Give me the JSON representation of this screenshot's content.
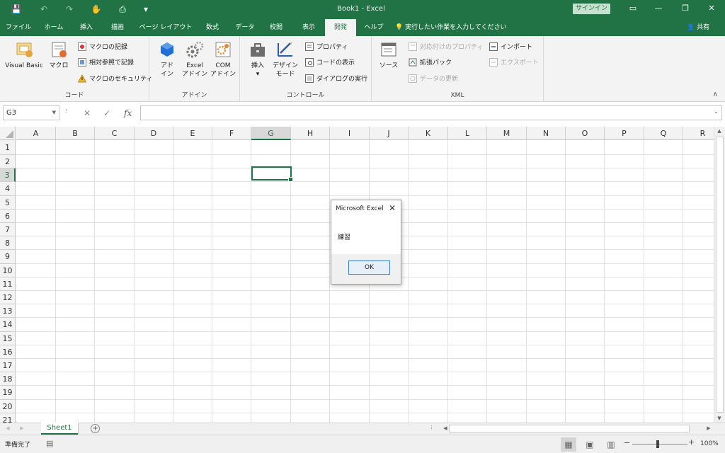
{
  "app": {
    "title": "Book1  -  Excel",
    "signin": "サインイン"
  },
  "quick_access": [
    {
      "icon": "save-icon",
      "glyph": "💾"
    },
    {
      "icon": "undo-icon",
      "glyph": "↶"
    },
    {
      "icon": "redo-icon",
      "glyph": "↷"
    },
    {
      "icon": "touch-mode-icon",
      "glyph": "✋"
    },
    {
      "icon": "print-preview-icon",
      "glyph": "⎙"
    },
    {
      "icon": "customize-icon",
      "glyph": "▾"
    }
  ],
  "window_buttons": [
    {
      "icon": "ribbon-display-icon",
      "glyph": "▭"
    },
    {
      "icon": "minimize-icon",
      "glyph": "—"
    },
    {
      "icon": "restore-icon",
      "glyph": "❐"
    },
    {
      "icon": "close-icon",
      "glyph": "✕"
    }
  ],
  "tabs": [
    {
      "label": "ファイル",
      "active": false
    },
    {
      "label": "ホーム",
      "active": false
    },
    {
      "label": "挿入",
      "active": false
    },
    {
      "label": "描画",
      "active": false
    },
    {
      "label": "ページ レイアウト",
      "active": false
    },
    {
      "label": "数式",
      "active": false
    },
    {
      "label": "データ",
      "active": false
    },
    {
      "label": "校閲",
      "active": false
    },
    {
      "label": "表示",
      "active": false
    },
    {
      "label": "開発",
      "active": true
    },
    {
      "label": "ヘルプ",
      "active": false
    }
  ],
  "tellme": "実行したい作業を入力してください",
  "share": "共有",
  "ribbon": {
    "code": {
      "label": "コード",
      "vb": "Visual Basic",
      "macro": "マクロ",
      "record": "マクロの記録",
      "relative": "相対参照で記録",
      "security": "マクロのセキュリティ"
    },
    "addins": {
      "label": "アドイン",
      "addin_1": "アド",
      "addin_2": "イン",
      "excel_1": "Excel",
      "excel_2": "アドイン",
      "com_1": "COM",
      "com_2": "アドイン"
    },
    "controls": {
      "label": "コントロール",
      "insert": "挿入",
      "design_1": "デザイン",
      "design_2": "モード",
      "properties": "プロパティ",
      "view_code": "コードの表示",
      "run_dialog": "ダイアログの実行"
    },
    "xml": {
      "label": "XML",
      "source": "ソース",
      "map_props": "対応付けのプロパティ",
      "expansion": "拡張パック",
      "refresh": "データの更新",
      "import": "インポート",
      "export": "エクスポート"
    }
  },
  "formula_bar": {
    "name_box": "G3",
    "cancel": "✕",
    "enter": "✓",
    "fx": "fx",
    "content": ""
  },
  "grid": {
    "columns": [
      "A",
      "B",
      "C",
      "D",
      "E",
      "F",
      "G",
      "H",
      "I",
      "J",
      "K",
      "L",
      "M",
      "N",
      "O",
      "P",
      "Q",
      "R"
    ],
    "rows": [
      "1",
      "2",
      "3",
      "4",
      "5",
      "6",
      "7",
      "8",
      "9",
      "10",
      "11",
      "12",
      "13",
      "14",
      "15",
      "16",
      "17",
      "18",
      "19",
      "20",
      "21"
    ],
    "active_cell": "G3"
  },
  "sheets": {
    "tab": "Sheet1",
    "add": "+"
  },
  "status": {
    "text": "準備完了",
    "zoom": "100%",
    "zoom_minus": "−",
    "zoom_plus": "+"
  },
  "dialog": {
    "title": "Microsoft Excel",
    "message": "練習",
    "ok": "OK",
    "close": "✕"
  },
  "colors": {
    "accent": "#217346",
    "ribbon_bg": "#f3f3f3"
  }
}
